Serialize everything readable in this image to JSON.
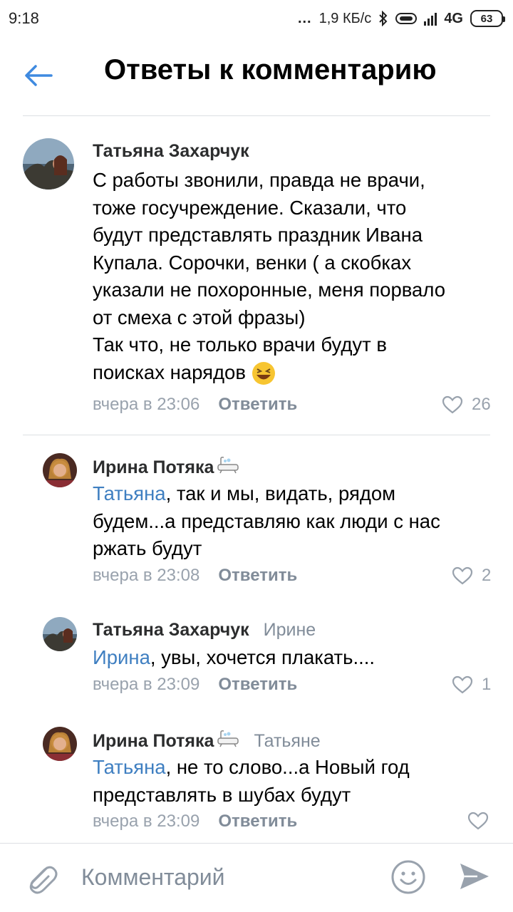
{
  "status_bar": {
    "time": "9:18",
    "dots": "...",
    "net_speed": "1,9 КБ/с",
    "network": "4G",
    "battery": "63"
  },
  "header": {
    "title": "Ответы к комментарию"
  },
  "comments": [
    {
      "author": "Татьяна Захарчук",
      "reply_to": "",
      "mention": "",
      "text_lines": [
        "С работы звонили, правда не врачи,",
        "тоже  госучреждение. Сказали, что",
        "будут представлять праздник Ивана",
        "Купала. Сорочки, венки ( а скобках",
        "указали не похоронные, меня порвало",
        "от смеха с этой фразы)",
        "Так что, не только врачи будут в",
        "поисках нарядов"
      ],
      "emoji": "😆",
      "time": "вчера в 23:06",
      "reply_label": "Ответить",
      "likes": "26"
    },
    {
      "author": "Ирина Потяка",
      "reply_to": "",
      "mention": "Татьяна",
      "text_lines": [
        ", так и мы, видать, рядом",
        "будем...а представляю как люди с нас",
        "ржать будут"
      ],
      "time": "вчера в 23:08",
      "reply_label": "Ответить",
      "likes": "2"
    },
    {
      "author": "Татьяна Захарчук",
      "reply_to": "Ирине",
      "mention": "Ирина",
      "text_lines": [
        ", увы, хочется плакать...."
      ],
      "time": "вчера в 23:09",
      "reply_label": "Ответить",
      "likes": "1"
    },
    {
      "author": "Ирина Потяка",
      "reply_to": "Татьяне",
      "mention": "Татьяна",
      "text_lines": [
        ", не то слово...а Новый год",
        "представлять в шубах будут"
      ],
      "time": "вчера в 23:09",
      "reply_label": "Ответить",
      "likes": ""
    }
  ],
  "composer": {
    "placeholder": "Комментарий"
  },
  "colors": {
    "accent": "#3f7fc1",
    "meta": "#99a2ad",
    "divider": "#dcdfe3"
  }
}
